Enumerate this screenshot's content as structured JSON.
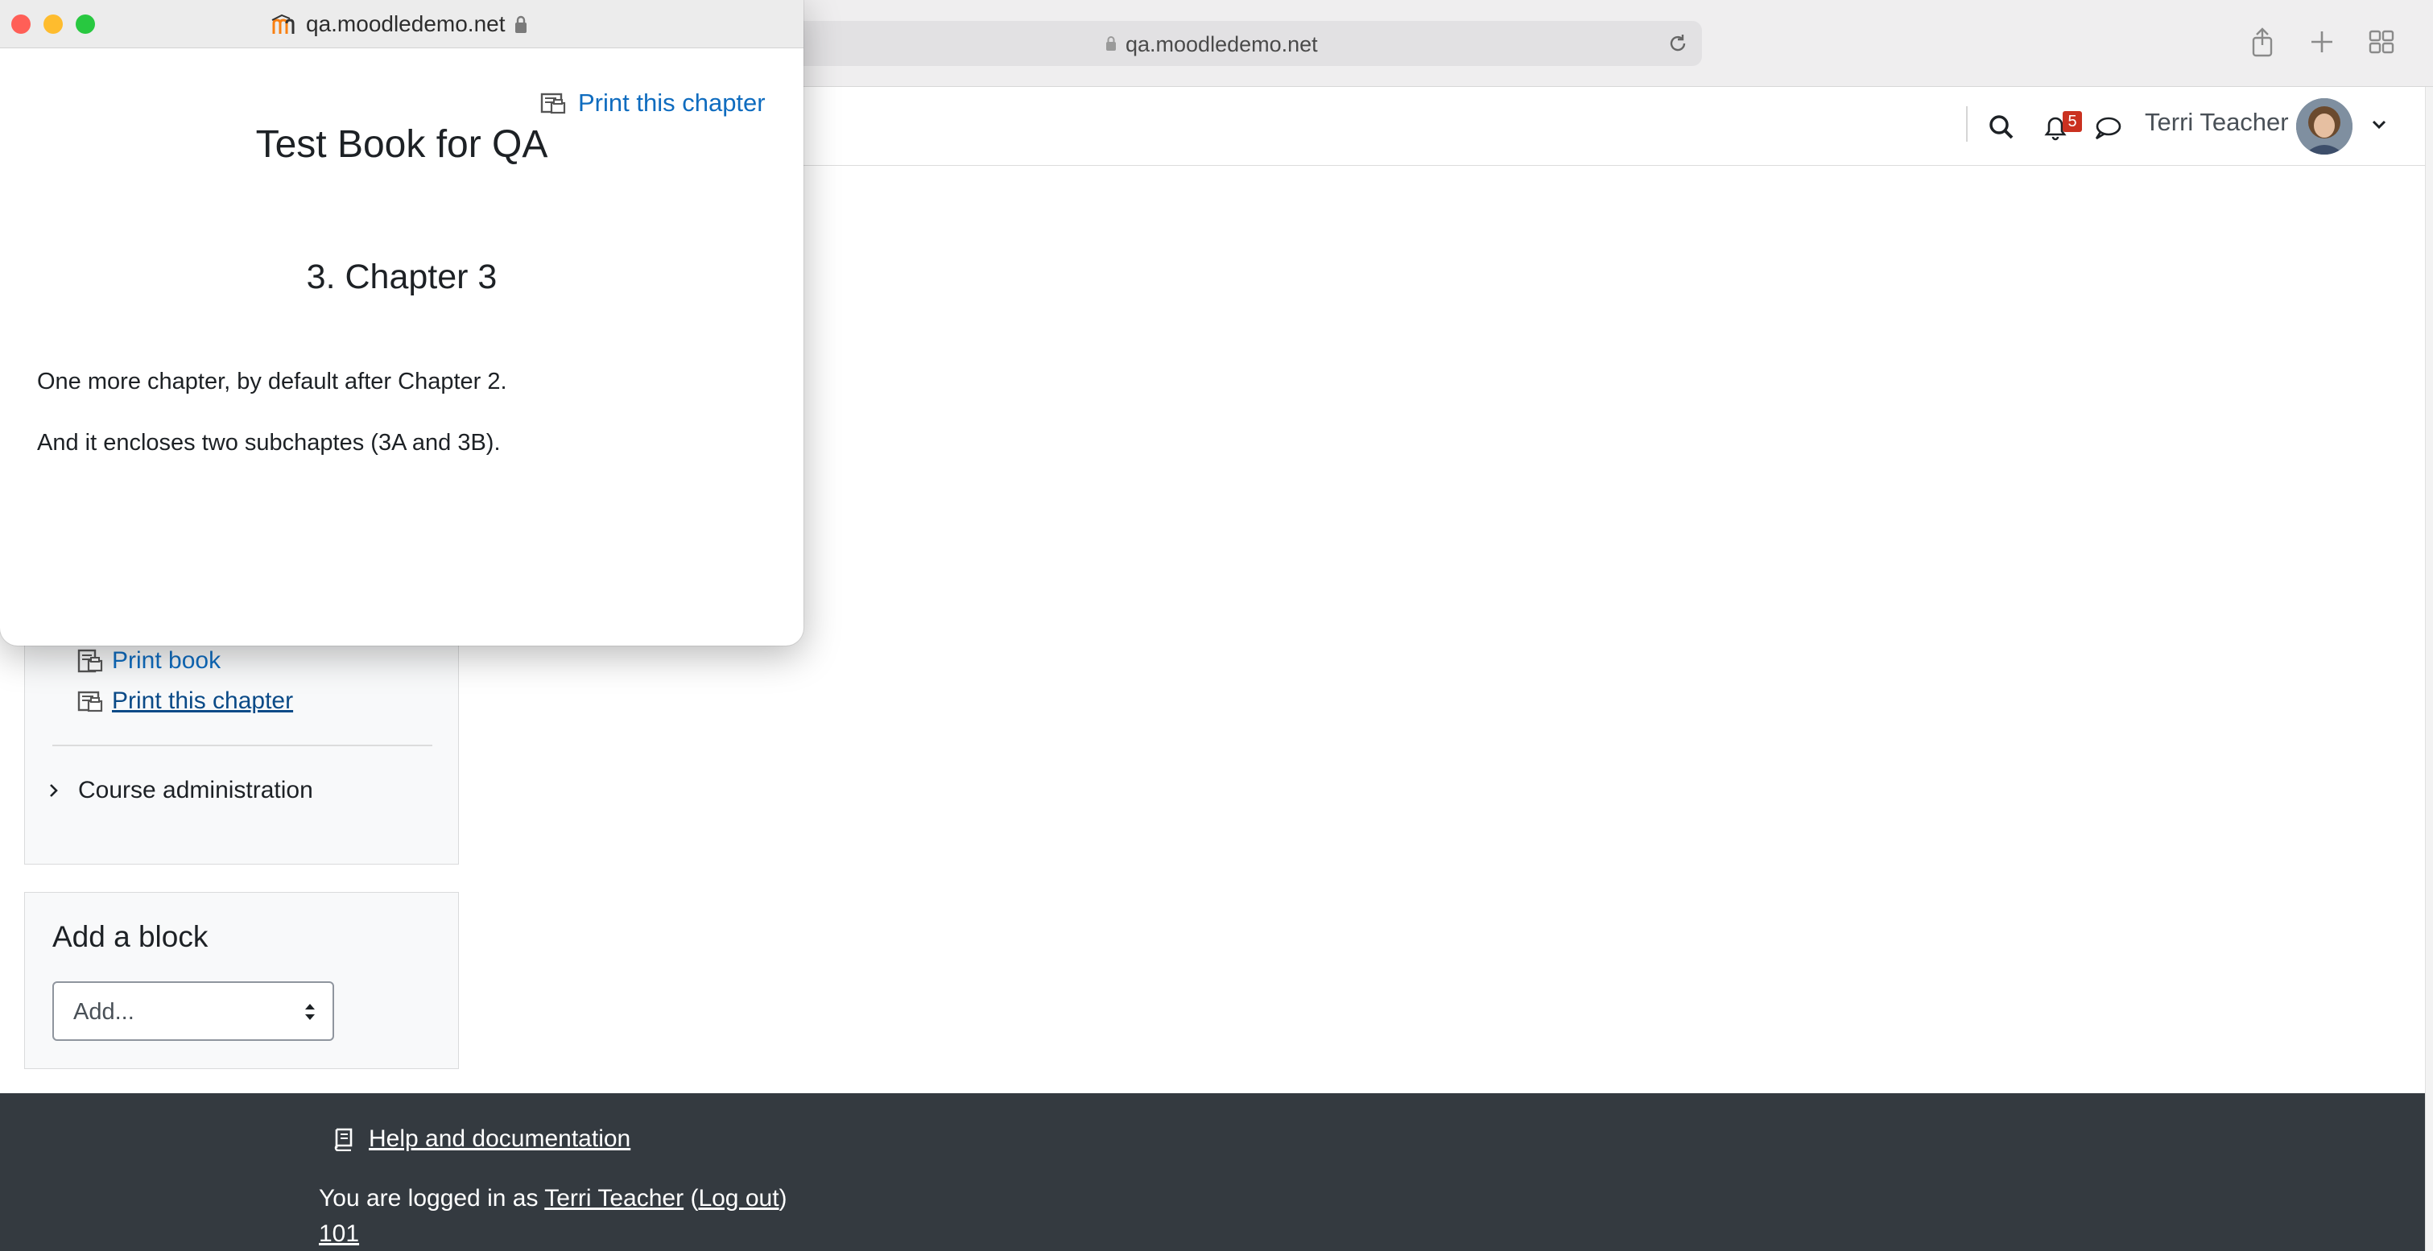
{
  "browser": {
    "host": "qa.moodledemo.net"
  },
  "navbar": {
    "notification_count": "5",
    "user_name": "Terri Teacher"
  },
  "nav_block": {
    "print_book": "Print book",
    "print_chapter": "Print this chapter",
    "course_admin": "Course administration"
  },
  "add_block": {
    "title": "Add a block",
    "select_value": "Add..."
  },
  "footer": {
    "help": "Help and documentation",
    "logged_prefix": "You are logged in as ",
    "logged_user": "Terri Teacher",
    "paren_open": " (",
    "logout": "Log out",
    "paren_close": ")",
    "course_code": "101"
  },
  "popup": {
    "host": "qa.moodledemo.net",
    "print_chapter": "Print this chapter",
    "book_title": "Test Book for QA",
    "chapter_title": "3. Chapter 3",
    "paragraphs": [
      "One more chapter, by default after Chapter 2.",
      "And it encloses two subchaptes (3A and 3B)."
    ]
  },
  "colors": {
    "link": "#0f6cbf",
    "footer_bg": "#343a40",
    "badge": "#ca3120",
    "traffic_close": "#ff5f57",
    "traffic_min": "#febc2e",
    "traffic_max": "#28c840"
  }
}
